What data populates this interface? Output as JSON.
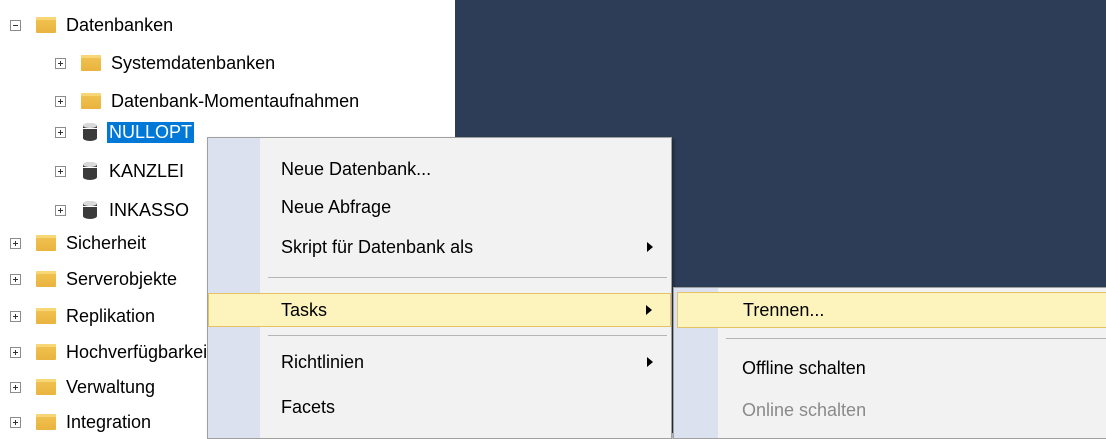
{
  "tree": {
    "nodes": [
      {
        "label": "Datenbanken",
        "expander": "minus",
        "icon": "folder-icon"
      },
      {
        "label": "Systemdatenbanken",
        "expander": "plus",
        "icon": "folder-icon"
      },
      {
        "label": "Datenbank-Momentaufnahmen",
        "expander": "plus",
        "icon": "folder-icon"
      },
      {
        "label": "NULLOPT",
        "expander": "plus",
        "icon": "database-icon",
        "selected": true
      },
      {
        "label": "KANZLEI",
        "expander": "plus",
        "icon": "database-icon"
      },
      {
        "label": "INKASSO",
        "expander": "plus",
        "icon": "database-icon"
      },
      {
        "label": "Sicherheit",
        "expander": "plus",
        "icon": "folder-icon"
      },
      {
        "label": "Serverobjekte",
        "expander": "plus",
        "icon": "folder-icon"
      },
      {
        "label": "Replikation",
        "expander": "plus",
        "icon": "folder-icon"
      },
      {
        "label": "Hochverfügbarkeit",
        "expander": "plus",
        "icon": "folder-icon"
      },
      {
        "label": "Verwaltung",
        "expander": "plus",
        "icon": "folder-icon"
      },
      {
        "label": "Integration",
        "expander": "plus",
        "icon": "folder-icon"
      }
    ]
  },
  "context_menu": {
    "items": [
      {
        "label": "Neue Datenbank...",
        "submenu": false
      },
      {
        "label": "Neue Abfrage",
        "submenu": false
      },
      {
        "label": "Skript für Datenbank als",
        "submenu": true
      },
      {
        "label": "Tasks",
        "submenu": true,
        "highlighted": true
      },
      {
        "label": "Richtlinien",
        "submenu": true
      },
      {
        "label": "Facets",
        "submenu": false
      }
    ]
  },
  "tasks_submenu": {
    "items": [
      {
        "label": "Trennen...",
        "highlighted": true
      },
      {
        "label": "Offline schalten",
        "enabled": true
      },
      {
        "label": "Online schalten",
        "enabled": false
      }
    ]
  },
  "colors": {
    "dark_pane": "#2d3d57",
    "selection": "#0078d7",
    "menu_highlight": "#fcf3bd",
    "menu_gutter": "#dbe1ee"
  }
}
